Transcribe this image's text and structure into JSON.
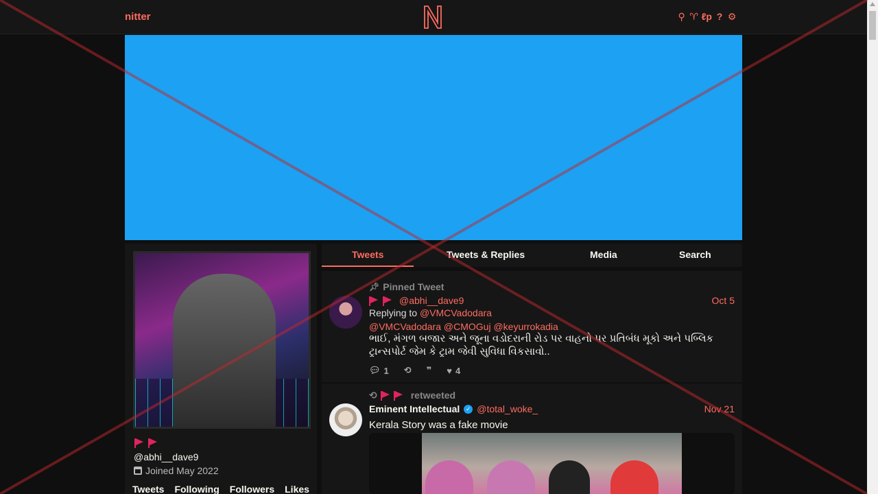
{
  "navbar": {
    "brand": "nitter",
    "logo_letter": "N",
    "icons": [
      "search-icon",
      "twitter-bird-icon",
      "lp-icon",
      "help-icon",
      "settings-icon"
    ],
    "icon_glyphs": {
      "search": "⚲",
      "bird": "♈",
      "lp": "ℓp",
      "help": "?",
      "settings": "⚙"
    }
  },
  "profile": {
    "handle": "@abhi__dave9",
    "joined": "Joined May 2022",
    "stats": [
      "Tweets",
      "Following",
      "Followers",
      "Likes"
    ]
  },
  "tabs": [
    "Tweets",
    "Tweets & Replies",
    "Media",
    "Search"
  ],
  "tweets": [
    {
      "meta": "Pinned Tweet",
      "username": "@abhi__dave9",
      "date": "Oct 5",
      "replying_label": "Replying to",
      "replying_to": "@VMCVadodara",
      "mentions": [
        "@VMCVadodara",
        "@CMOGuj",
        "@keyurrokadia"
      ],
      "text": "ભાઈ, મંગળ બજાર અને જૂના વડોદરાની રોડ પર વાહનો પર પ્રતિબંધ મૂકો અને પબ્લિક ટ્રાન્સપોર્ટ જેમ કે ટ્રામ જેવી સુવિધા વિકસાવો..",
      "replies": "1",
      "likes": "4"
    },
    {
      "meta": "retweeted",
      "name": "Eminent Intellectual",
      "username": "@total_woke_",
      "date": "Nov 21",
      "text": "Kerala Story was a fake movie"
    }
  ],
  "colors": {
    "accent": "#ff6c60",
    "banner": "#1da1f2",
    "bg": "#0f0f0f",
    "panel": "#161616"
  }
}
